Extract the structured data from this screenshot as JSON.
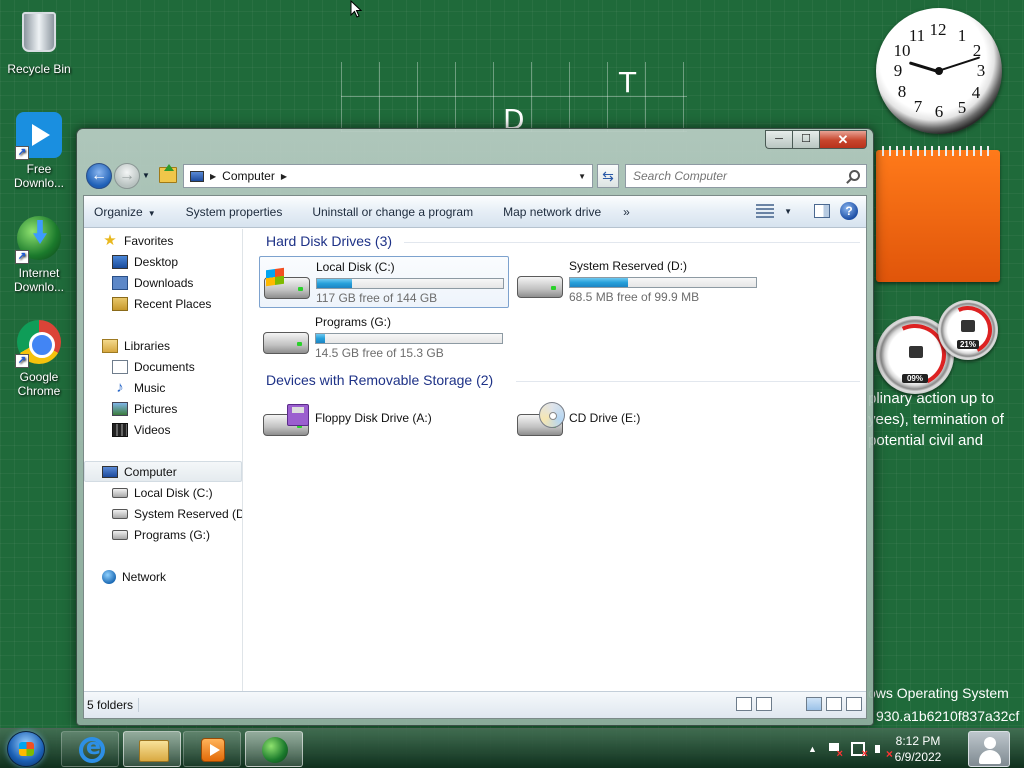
{
  "desktop": {
    "icons": [
      {
        "label": "Recycle Bin",
        "icon": "recycle-bin-icon"
      },
      {
        "label": "Free Downlo...",
        "icon": "free-download-manager-icon"
      },
      {
        "label": "Internet Downlo...",
        "icon": "internet-download-manager-icon"
      },
      {
        "label": "Google Chrome",
        "icon": "chrome-icon"
      }
    ],
    "grid_letters": [
      "T",
      "D"
    ],
    "background_text": [
      "plinary action up to",
      "yees), termination of",
      "potential civil and"
    ],
    "watermark": [
      "ows Operating System",
      "930.a1b6210f837a32cf"
    ],
    "clock_gadget": {
      "numerals": [
        "12",
        "1",
        "2",
        "3",
        "4",
        "5",
        "6",
        "7",
        "8",
        "9",
        "10",
        "11"
      ]
    },
    "meter_gadget": {
      "cpu": "09%",
      "memory": "21%"
    },
    "accent": "#1f6a3a"
  },
  "window": {
    "caption": {
      "minimize": "─",
      "maximize": "☐",
      "close": "✕"
    },
    "address": {
      "location": "Computer",
      "search_placeholder": "Search Computer"
    },
    "toolbar": {
      "organize": "Organize",
      "system_properties": "System properties",
      "uninstall": "Uninstall or change a program",
      "map_drive": "Map network drive",
      "more": "»"
    },
    "nav": {
      "favorites": "Favorites",
      "desktop": "Desktop",
      "downloads": "Downloads",
      "recent": "Recent Places",
      "libraries": "Libraries",
      "documents": "Documents",
      "music": "Music",
      "pictures": "Pictures",
      "videos": "Videos",
      "computer": "Computer",
      "drive_c": "Local Disk (C:)",
      "drive_d": "System Reserved (D:",
      "drive_g": "Programs (G:)",
      "network": "Network"
    },
    "groups": {
      "hdd": "Hard Disk Drives (3)",
      "removable": "Devices with Removable Storage (2)"
    },
    "drives": [
      {
        "name": "Local Disk (C:)",
        "free": "117 GB free of 144 GB",
        "used_fraction": 0.19
      },
      {
        "name": "System Reserved (D:)",
        "free": "68.5 MB free of 99.9 MB",
        "used_fraction": 0.31
      },
      {
        "name": "Programs (G:)",
        "free": "14.5 GB free of 15.3 GB",
        "used_fraction": 0.05
      }
    ],
    "removable": [
      {
        "name": "Floppy Disk Drive (A:)"
      },
      {
        "name": "CD Drive (E:)"
      }
    ],
    "status": "5 folders"
  },
  "taskbar": {
    "time": "8:12 PM",
    "date": "6/9/2022",
    "tray_expand": "▲"
  }
}
